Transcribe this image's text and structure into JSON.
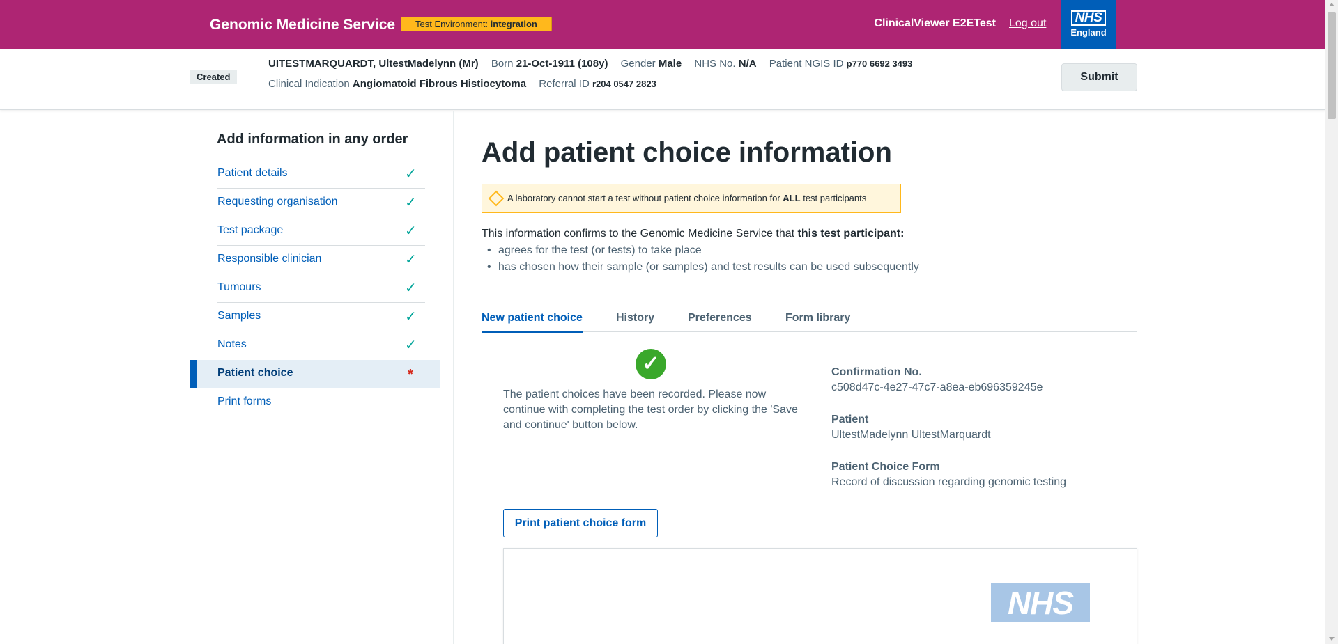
{
  "header": {
    "service_name": "Genomic Medicine Service",
    "env_label": "Test Environment:",
    "env_value": "integration",
    "user_name": "ClinicalViewer E2ETest",
    "logout_label": "Log out",
    "logo_mark": "NHS",
    "logo_region": "England"
  },
  "banner": {
    "status": "Created",
    "patient_name": "UITESTMARQUARDT, UltestMadelynn (Mr)",
    "born_label": "Born",
    "born_value": "21-Oct-1911 (108y)",
    "gender_label": "Gender",
    "gender_value": "Male",
    "nhs_label": "NHS No.",
    "nhs_value": "N/A",
    "ngis_label": "Patient NGIS ID",
    "ngis_value": "p770 6692 3493",
    "ci_label": "Clinical Indication",
    "ci_value": "Angiomatoid Fibrous Histiocytoma",
    "referral_label": "Referral ID",
    "referral_value": "r204 0547 2823",
    "submit_label": "Submit"
  },
  "sidebar": {
    "title": "Add information in any order",
    "items": [
      {
        "label": "Patient details",
        "status": "✓"
      },
      {
        "label": "Requesting organisation",
        "status": "✓"
      },
      {
        "label": "Test package",
        "status": "✓"
      },
      {
        "label": "Responsible clinician",
        "status": "✓"
      },
      {
        "label": "Tumours",
        "status": "✓"
      },
      {
        "label": "Samples",
        "status": "✓"
      },
      {
        "label": "Notes",
        "status": "✓"
      },
      {
        "label": "Patient choice",
        "status": "*"
      },
      {
        "label": "Print forms",
        "status": ""
      }
    ]
  },
  "main": {
    "title": "Add patient choice information",
    "warning_pre": "A laboratory cannot start a test without patient choice information for",
    "warning_bold": "ALL",
    "warning_post": "test participants",
    "intro_pre": "This information confirms to the Genomic Medicine Service that",
    "intro_bold": "this test participant:",
    "bullets": [
      "agrees for the test (or tests) to take place",
      "has chosen how their sample (or samples) and test results can be used subsequently"
    ],
    "tabs": [
      "New patient choice",
      "History",
      "Preferences",
      "Form library"
    ],
    "success_icon": "✓",
    "success_message": "The patient choices have been recorded. Please now continue with completing the test order by clicking the 'Save and continue' button below.",
    "confirmation_label": "Confirmation No.",
    "confirmation_value": "c508d47c-4e27-47c7-a8ea-eb696359245e",
    "patient_label": "Patient",
    "patient_value": "UltestMadelynn UltestMarquardt",
    "form_label": "Patient Choice Form",
    "form_value": "Record of discussion regarding genomic testing",
    "print_button": "Print patient choice form",
    "preview_logo": "NHS"
  }
}
